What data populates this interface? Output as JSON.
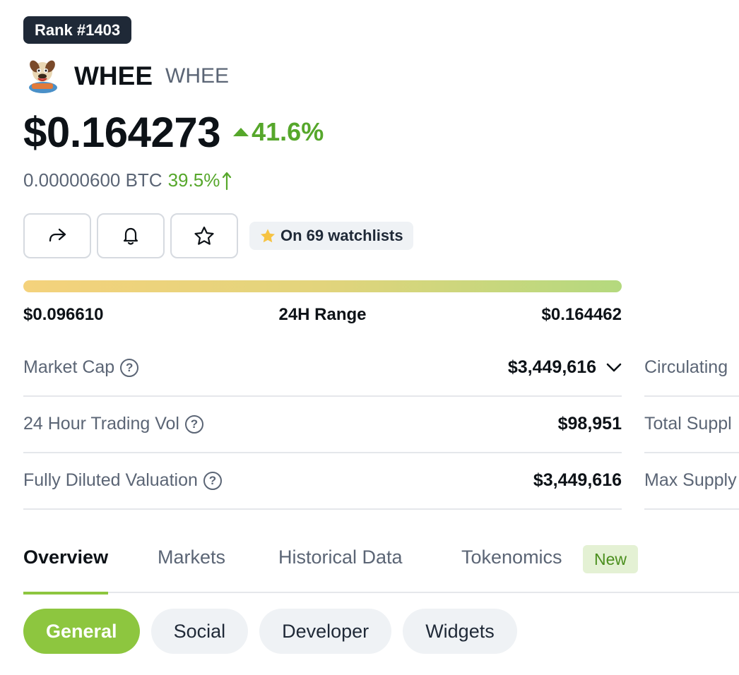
{
  "rank": "Rank #1403",
  "coin": {
    "name": "WHEE",
    "symbol": "WHEE",
    "logo_icon": "dog-mascot-logo"
  },
  "price": {
    "usd": "$0.164273",
    "change_24h": "41.6%",
    "btc": "0.00000600 BTC",
    "btc_change": "39.5%"
  },
  "actions": {
    "share_icon": "share-icon",
    "alert_icon": "bell-icon",
    "watchlist_icon": "star-icon",
    "watchlist_text": "On 69 watchlists"
  },
  "range": {
    "low": "$0.096610",
    "title": "24H Range",
    "high": "$0.164462",
    "position_fraction": 0.997
  },
  "stats": [
    {
      "label": "Market Cap",
      "value": "$3,449,616"
    },
    {
      "label": "24 Hour Trading Vol",
      "value": "$98,951"
    },
    {
      "label": "Fully Diluted Valuation",
      "value": "$3,449,616"
    }
  ],
  "side_stats": [
    {
      "label": "Circulating"
    },
    {
      "label": "Total Suppl"
    },
    {
      "label": "Max Supply"
    }
  ],
  "tabs": [
    {
      "label": "Overview",
      "active": true
    },
    {
      "label": "Markets"
    },
    {
      "label": "Historical Data"
    },
    {
      "label": "Tokenomics",
      "badge": "New"
    }
  ],
  "subtabs": [
    {
      "label": "General",
      "active": true
    },
    {
      "label": "Social"
    },
    {
      "label": "Developer"
    },
    {
      "label": "Widgets"
    }
  ],
  "colors": {
    "positive": "#56a72b",
    "accent": "#8dc63f",
    "badge_dark": "#1f2937"
  }
}
